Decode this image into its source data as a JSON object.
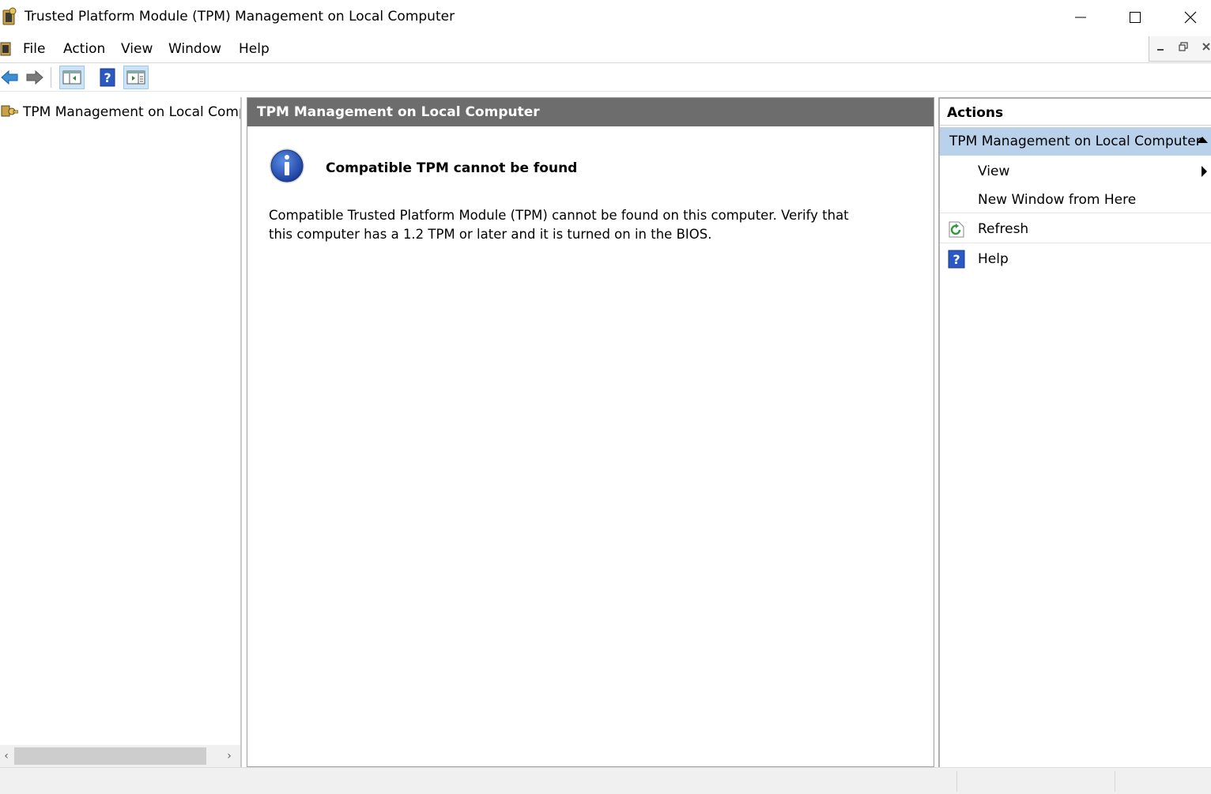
{
  "window": {
    "title": "Trusted Platform Module (TPM) Management on Local Computer",
    "app_icon": "tpm-chip-key-icon",
    "controls": [
      "minimize-icon",
      "maximize-icon",
      "close-icon"
    ]
  },
  "menubar": {
    "items": [
      {
        "label": "File"
      },
      {
        "label": "Action"
      },
      {
        "label": "View"
      },
      {
        "label": "Window"
      },
      {
        "label": "Help"
      }
    ],
    "mdi_controls": [
      "minimize-icon",
      "restore-icon",
      "close-icon"
    ]
  },
  "toolbar": {
    "buttons": [
      "back-arrow-icon",
      "forward-arrow-icon",
      "show-hide-console-tree-icon",
      "help-icon",
      "show-hide-action-pane-icon"
    ]
  },
  "tree": {
    "root_label": "TPM Management on Local Computer",
    "root_icon": "tpm-key-icon"
  },
  "center": {
    "header": "TPM Management on Local Computer",
    "message_title": "Compatible TPM cannot be found",
    "message_body": "Compatible Trusted Platform Module (TPM) cannot be found on this computer. Verify that this computer has a 1.2 TPM or later and it is turned on in the BIOS.",
    "message_icon": "info-icon"
  },
  "actions": {
    "header": "Actions",
    "group_label": "TPM Management on Local Computer",
    "items": [
      {
        "label": "View",
        "icon": null,
        "submenu": true
      },
      {
        "label": "New Window from Here",
        "icon": null,
        "submenu": false
      },
      {
        "label": "Refresh",
        "icon": "refresh-icon",
        "submenu": false
      },
      {
        "label": "Help",
        "icon": "help-icon",
        "submenu": false
      }
    ]
  },
  "colors": {
    "center_header_bg": "#6d6d6d",
    "actions_group_bg": "#b9d1ea",
    "toolbar_pressed_bg": "#cce4f7",
    "info_blue": "#1c4fb8"
  }
}
